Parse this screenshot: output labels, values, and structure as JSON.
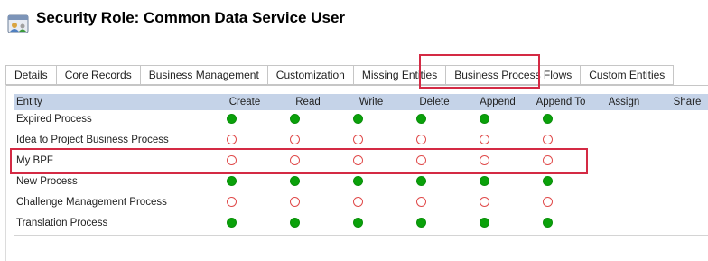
{
  "header": {
    "title": "Security Role: Common Data Service User",
    "icon": "security-role-icon"
  },
  "tabs": [
    {
      "label": "Details"
    },
    {
      "label": "Core Records"
    },
    {
      "label": "Business Management"
    },
    {
      "label": "Customization"
    },
    {
      "label": "Missing Entities"
    },
    {
      "label": "Business Process Flows",
      "active": true
    },
    {
      "label": "Custom Entities"
    }
  ],
  "grid": {
    "columns": [
      "Entity",
      "Create",
      "Read",
      "Write",
      "Delete",
      "Append",
      "Append To",
      "Assign",
      "Share"
    ],
    "rows": [
      {
        "name": "Expired Process",
        "privileges": [
          "full",
          "full",
          "full",
          "full",
          "full",
          "full"
        ]
      },
      {
        "name": "Idea to Project Business Process",
        "privileges": [
          "none",
          "none",
          "none",
          "none",
          "none",
          "none"
        ]
      },
      {
        "name": "My BPF",
        "privileges": [
          "none",
          "none",
          "none",
          "none",
          "none",
          "none"
        ]
      },
      {
        "name": "New Process",
        "privileges": [
          "full",
          "full",
          "full",
          "full",
          "full",
          "full"
        ]
      },
      {
        "name": "Challenge Management Process",
        "privileges": [
          "none",
          "none",
          "none",
          "none",
          "none",
          "none"
        ]
      },
      {
        "name": "Translation Process",
        "privileges": [
          "full",
          "full",
          "full",
          "full",
          "full",
          "full"
        ]
      }
    ]
  },
  "colors": {
    "grid_header_bg": "#c5d3e8",
    "full_privilege": "#0aa10a",
    "no_privilege": "#e04a4a",
    "highlight": "#d42a44"
  }
}
